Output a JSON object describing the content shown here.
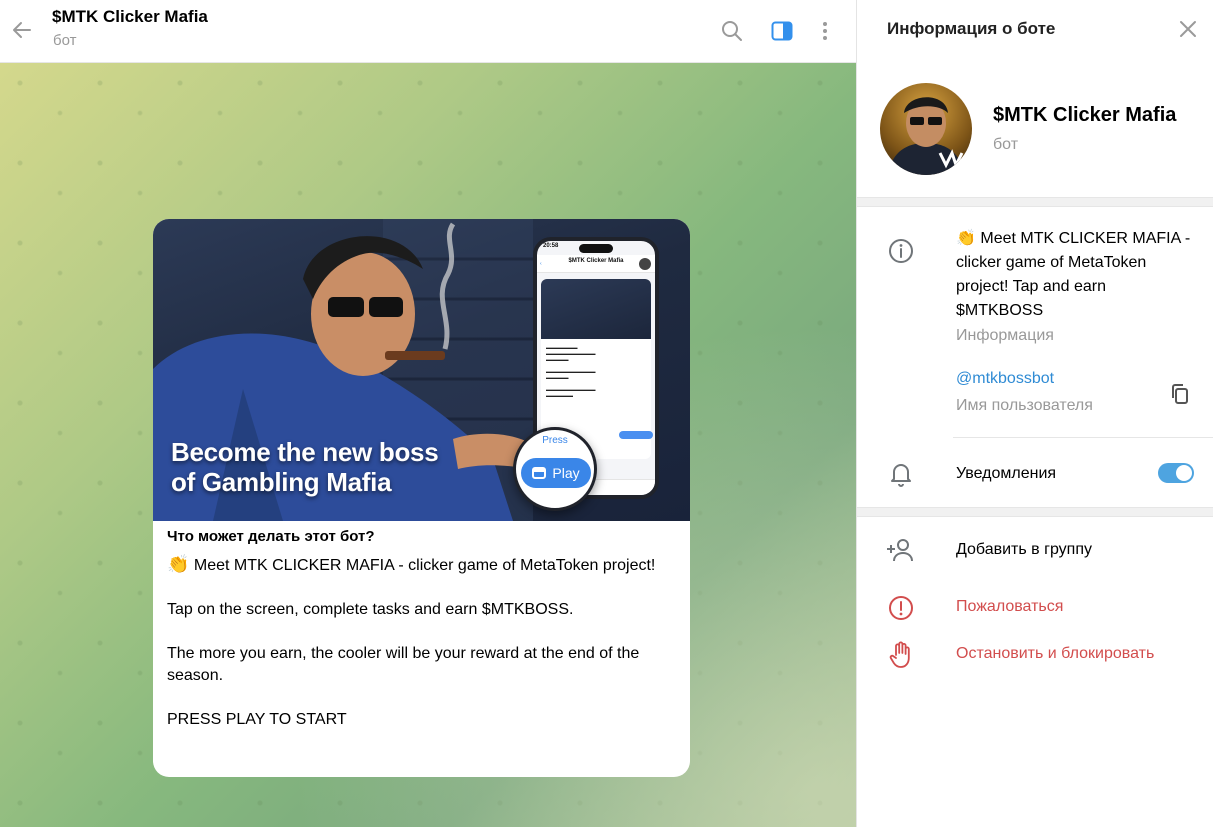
{
  "chat": {
    "title": "$MTK Clicker Mafia",
    "subtitle": "бот"
  },
  "message": {
    "promo_line1": "Become the new boss",
    "promo_line2": "of Gambling Mafia",
    "phone_title": "$MTK Clicker Mafia",
    "phone_time": "20:58",
    "lens_press": "Press",
    "lens_play": "Play",
    "heading": "Что может делать этот бот?",
    "emoji": "👏",
    "line1": "Meet MTK CLICKER MAFIA - clicker game of MetaToken project!",
    "line2": "Tap on the screen, complete tasks and earn $MTKBOSS.",
    "line3": "The more you earn, the cooler will be your reward at the end of the season.",
    "line4": "PRESS PLAY TO START"
  },
  "panel": {
    "title": "Информация о боте",
    "name": "$MTK Clicker Mafia",
    "subtitle": "бот",
    "info_text": "👏 Meet MTK CLICKER MAFIA - clicker game of MetaToken project! Tap and earn $MTKBOSS",
    "info_label": "Информация",
    "username": "@mtkbossbot",
    "username_label": "Имя пользователя",
    "notifications_label": "Уведомления",
    "notifications_on": true,
    "add_to_group": "Добавить в группу",
    "report": "Пожаловаться",
    "stop_block": "Остановить и блокировать"
  },
  "colors": {
    "accent": "#4ea4e0",
    "link": "#2f8bd4",
    "danger": "#d24d4d",
    "play_button": "#3a86e8"
  },
  "icons": {
    "back": "back-arrow-icon",
    "search": "search-icon",
    "sidebar": "sidebar-toggle-icon",
    "more": "more-vertical-icon",
    "close": "close-icon",
    "info": "info-icon",
    "copy": "copy-icon",
    "bell": "bell-icon",
    "add_user": "add-user-icon",
    "report": "report-icon",
    "stop": "hand-stop-icon"
  }
}
